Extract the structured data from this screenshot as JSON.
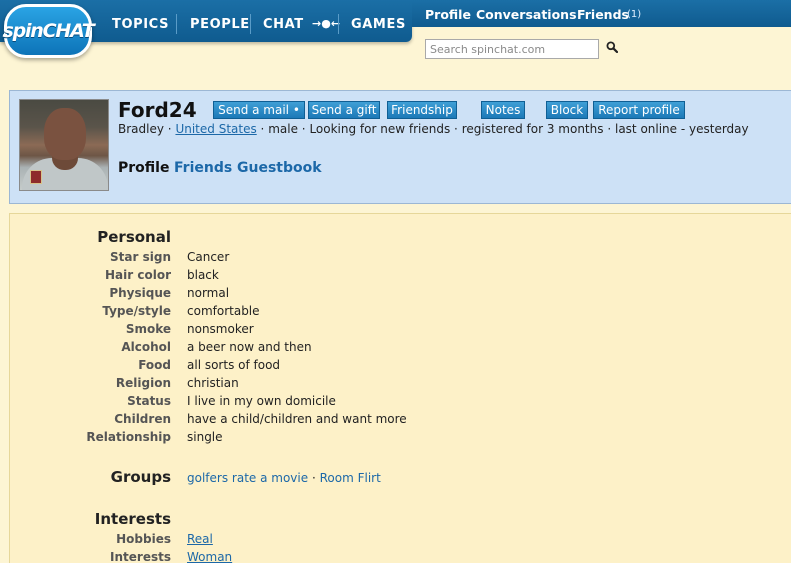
{
  "logo": {
    "text": "spinCHAT",
    "accent": "#1b6fa6"
  },
  "nav": {
    "topics": "TOPICS",
    "people": "PEOPLE",
    "chat": "CHAT",
    "chat_icon": "arrows-icon",
    "games": "GAMES"
  },
  "header": {
    "profile": "Profile",
    "conversations": "Conversations",
    "friends": "Friends",
    "friends_count": "(1)"
  },
  "search": {
    "placeholder": "Search spinchat.com",
    "value": ""
  },
  "profile": {
    "username": "Ford24",
    "first_name": "Bradley",
    "location": "United States",
    "gender": "male",
    "looking_for": "Looking for new friends",
    "registered": "registered for 3 months",
    "last_online": "last online - yesterday",
    "sep": "·",
    "actions": {
      "send_mail": "Send a mail •",
      "send_gift": "Send a gift",
      "friendship": "Friendship",
      "notes": "Notes",
      "block": "Block",
      "report": "Report profile"
    },
    "tabs": {
      "profile": "Profile",
      "friends": "Friends",
      "guestbook": "Guestbook"
    }
  },
  "personal": {
    "heading": "Personal",
    "rows": [
      {
        "label": "Star sign",
        "value": "Cancer"
      },
      {
        "label": "Hair color",
        "value": "black"
      },
      {
        "label": "Physique",
        "value": "normal"
      },
      {
        "label": "Type/style",
        "value": "comfortable"
      },
      {
        "label": "Smoke",
        "value": "nonsmoker"
      },
      {
        "label": "Alcohol",
        "value": "a beer now and then"
      },
      {
        "label": "Food",
        "value": "all sorts of food"
      },
      {
        "label": "Religion",
        "value": "christian"
      },
      {
        "label": "Status",
        "value": "I live in my own domicile"
      },
      {
        "label": "Children",
        "value": "have a child/children and want more"
      },
      {
        "label": "Relationship",
        "value": "single"
      }
    ]
  },
  "groups": {
    "heading": "Groups",
    "items": [
      "golfers rate a movie",
      "Room Flirt"
    ],
    "sep": "·"
  },
  "interests": {
    "heading": "Interests",
    "rows": [
      {
        "label": "Hobbies",
        "value": "Real"
      },
      {
        "label": "Interests",
        "value": "Woman"
      }
    ]
  }
}
